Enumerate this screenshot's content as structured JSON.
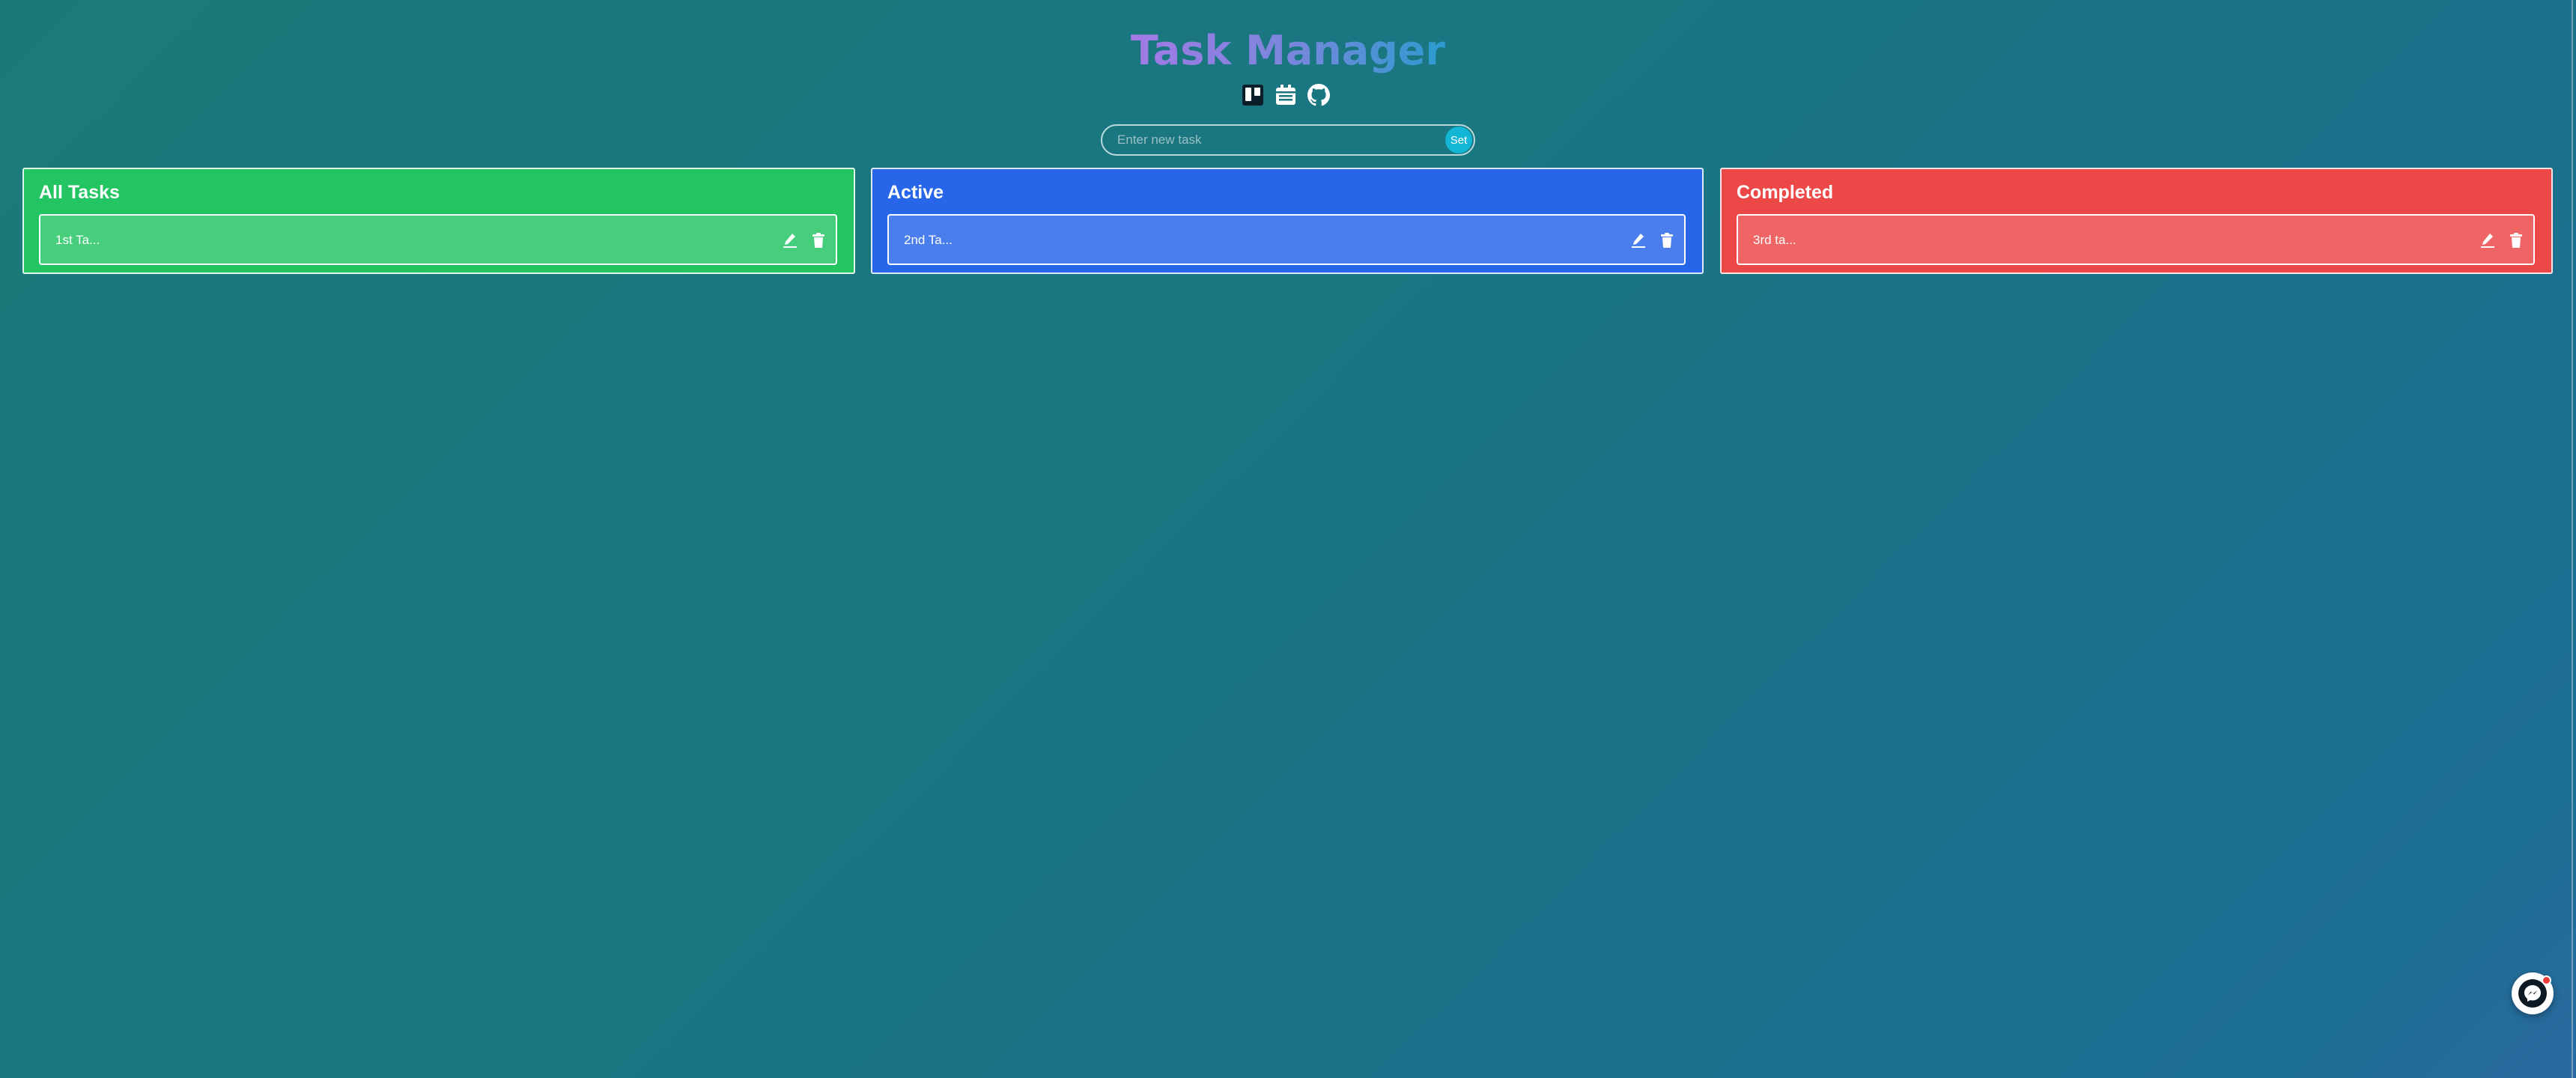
{
  "header": {
    "title": "Task Manager",
    "icons": [
      "kanban-board-icon",
      "calendar-icon",
      "github-icon"
    ]
  },
  "form": {
    "placeholder": "Enter new task",
    "value": "",
    "submit_label": "Set"
  },
  "columns": [
    {
      "title": "All Tasks",
      "color": "#23c563",
      "tasks": [
        {
          "text": "1st Ta...",
          "actions": [
            "edit-icon",
            "trash-icon"
          ]
        }
      ]
    },
    {
      "title": "Active",
      "color": "#2766e9",
      "tasks": [
        {
          "text": "2nd Ta...",
          "actions": [
            "edit-icon",
            "trash-icon"
          ]
        }
      ]
    },
    {
      "title": "Completed",
      "color": "#ec4848",
      "tasks": [
        {
          "text": "3rd ta...",
          "actions": [
            "edit-icon",
            "trash-icon"
          ]
        }
      ]
    }
  ],
  "chat_widget": {
    "icon": "messenger-icon",
    "badge_color": "#ee3b3b"
  },
  "colors": {
    "title_gradient": [
      "#a27ae6",
      "#7b86dc",
      "#2b9bd0"
    ],
    "accent": "#13b6d4"
  }
}
